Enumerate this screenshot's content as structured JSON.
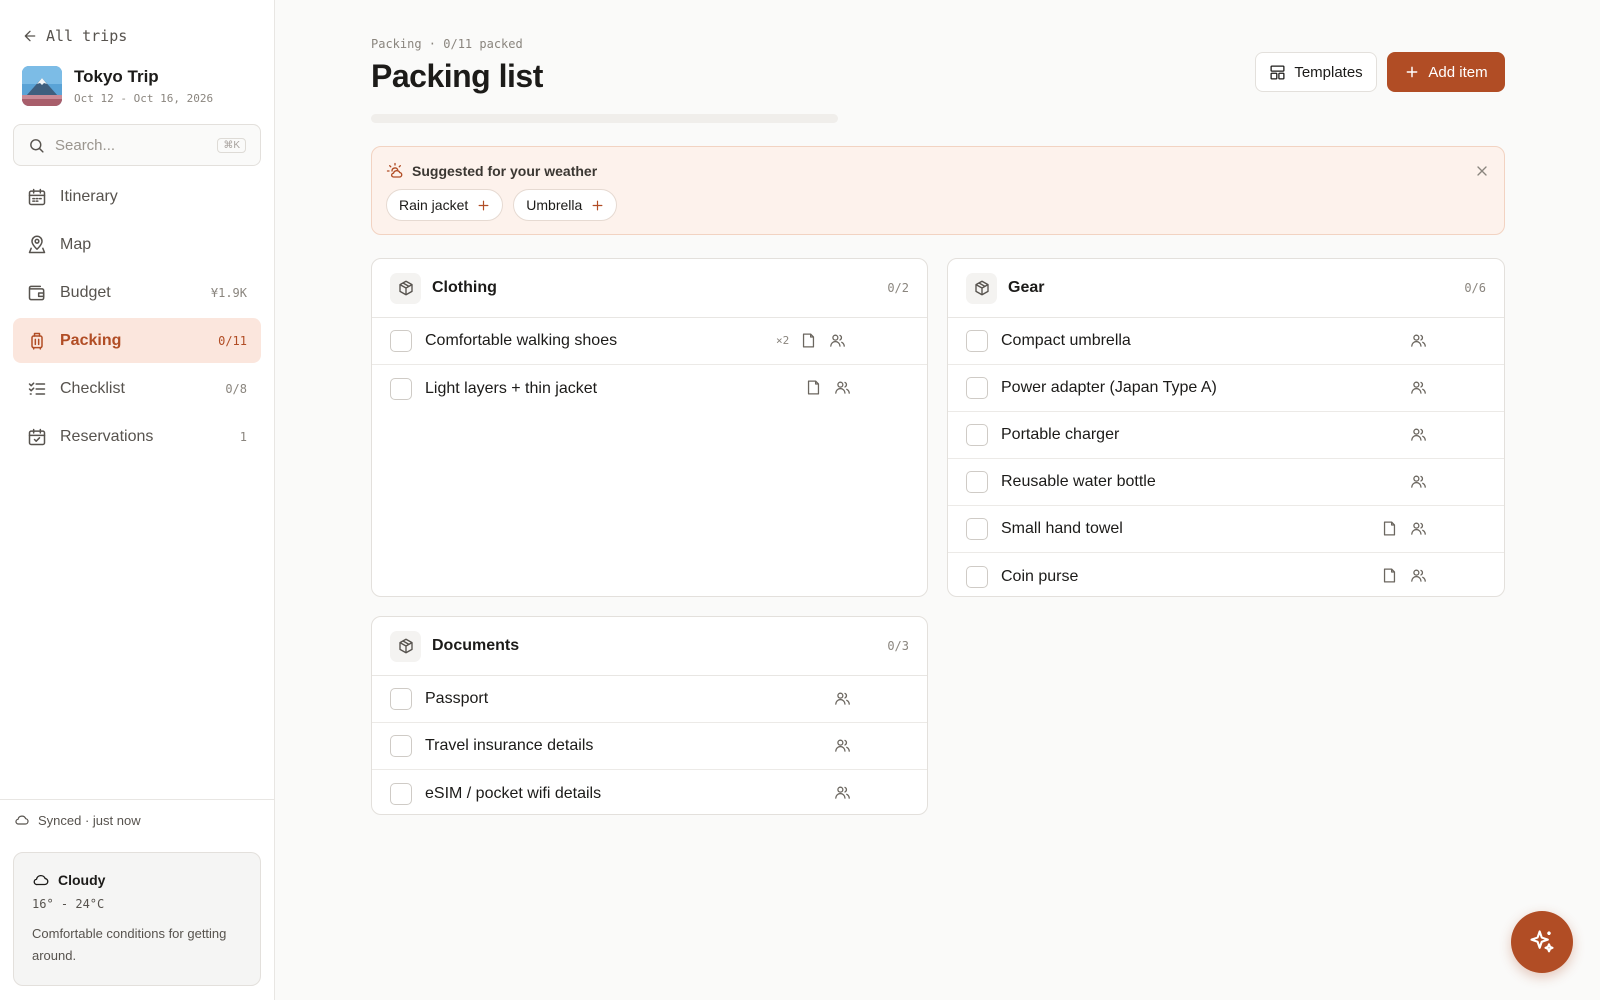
{
  "sidebar": {
    "back_label": "All trips",
    "trip": {
      "title": "Tokyo Trip",
      "dates": "Oct 12 - Oct 16, 2026"
    },
    "search": {
      "placeholder": "Search...",
      "shortcut": "⌘K"
    },
    "nav": [
      {
        "label": "Itinerary",
        "count": "",
        "icon": "calendar-icon"
      },
      {
        "label": "Map",
        "count": "",
        "icon": "map-pin-icon"
      },
      {
        "label": "Budget",
        "count": "¥1.9K",
        "icon": "wallet-icon"
      },
      {
        "label": "Packing",
        "count": "0/11",
        "icon": "luggage-icon",
        "active": true
      },
      {
        "label": "Checklist",
        "count": "0/8",
        "icon": "checklist-icon"
      },
      {
        "label": "Reservations",
        "count": "1",
        "icon": "calendar-check-icon"
      }
    ],
    "sync_status": "Synced · just now",
    "weather": {
      "condition": "Cloudy",
      "range": "16° - 24°C",
      "description": "Comfortable conditions for getting around."
    }
  },
  "header": {
    "breadcrumb": "Packing · 0/11 packed",
    "title": "Packing list",
    "progress_fraction": 0,
    "templates_label": "Templates",
    "add_item_label": "Add item"
  },
  "suggestions": {
    "title": "Suggested for your weather",
    "items": [
      "Rain jacket",
      "Umbrella"
    ]
  },
  "categories": {
    "clothing": {
      "name": "Clothing",
      "count": "0/2",
      "items": [
        {
          "name": "Comfortable walking shoes",
          "qty": "×2"
        },
        {
          "name": "Light layers + thin jacket"
        }
      ]
    },
    "gear": {
      "name": "Gear",
      "count": "0/6",
      "items": [
        {
          "name": "Compact umbrella"
        },
        {
          "name": "Power adapter (Japan Type A)"
        },
        {
          "name": "Portable charger"
        },
        {
          "name": "Reusable water bottle"
        },
        {
          "name": "Small hand towel"
        },
        {
          "name": "Coin purse"
        }
      ]
    },
    "documents": {
      "name": "Documents",
      "count": "0/3",
      "items": [
        {
          "name": "Passport"
        },
        {
          "name": "Travel insurance details"
        },
        {
          "name": "eSIM / pocket wifi details"
        }
      ]
    }
  },
  "colors": {
    "accent": "#b14d25",
    "accent_soft": "#fbe6dd",
    "suggest_bg": "#fdf2ec"
  }
}
